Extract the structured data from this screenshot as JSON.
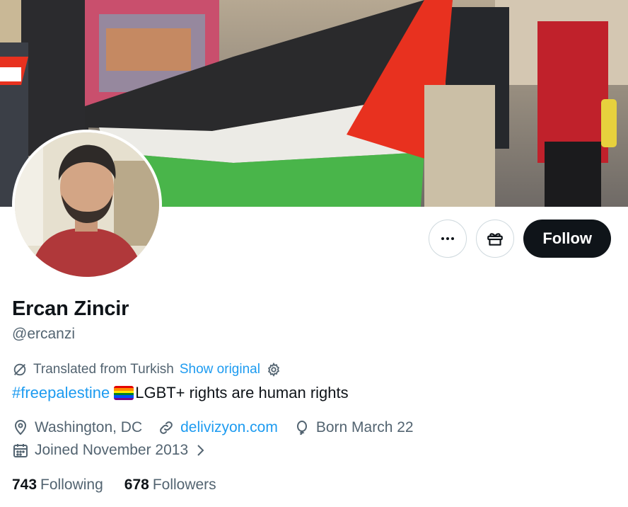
{
  "profile": {
    "name": "Ercan Zincir",
    "handle": "@ercanzi"
  },
  "actions": {
    "more_icon": "more-horizontal-icon",
    "gift_icon": "gift-icon",
    "follow_label": "Follow"
  },
  "translation": {
    "text": "Translated from Turkish",
    "show_original": "Show original"
  },
  "bio": {
    "hashtag": "#freepalestine",
    "emoji": "rainbow-flag",
    "text": "LGBT+ rights are human rights"
  },
  "meta": {
    "location": "Washington, DC",
    "website": "delivizyon.com",
    "birthday": "Born March 22",
    "joined": "Joined November 2013"
  },
  "stats": {
    "following_count": "743",
    "following_label": "Following",
    "followers_count": "678",
    "followers_label": "Followers"
  },
  "colors": {
    "accent": "#1d9bf0",
    "text_primary": "#0f1419",
    "text_secondary": "#536471",
    "follow_bg": "#0f1419"
  }
}
